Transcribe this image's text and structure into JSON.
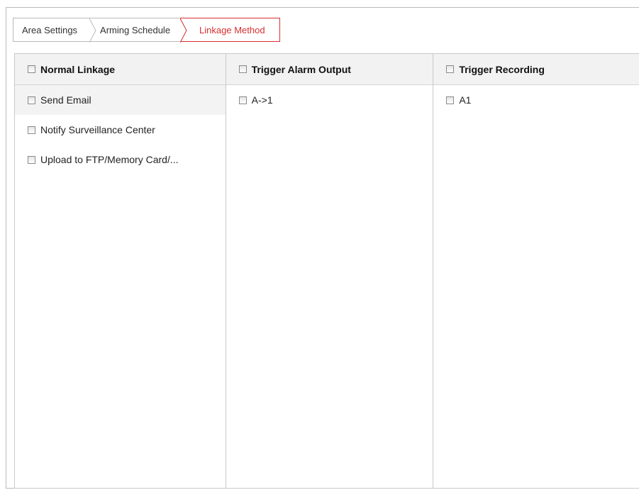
{
  "tabs": [
    {
      "label": "Area Settings",
      "active": false
    },
    {
      "label": "Arming Schedule",
      "active": false
    },
    {
      "label": "Linkage Method",
      "active": true
    }
  ],
  "accent_color": "#d62f2f",
  "columns": [
    {
      "header": "Normal Linkage",
      "items": [
        {
          "label": "Send Email",
          "checked": false
        },
        {
          "label": "Notify Surveillance Center",
          "checked": false
        },
        {
          "label": "Upload to FTP/Memory Card/...",
          "checked": false
        }
      ]
    },
    {
      "header": "Trigger Alarm Output",
      "items": [
        {
          "label": "A->1",
          "checked": false
        }
      ]
    },
    {
      "header": "Trigger Recording",
      "items": [
        {
          "label": "A1",
          "checked": false
        }
      ]
    }
  ]
}
